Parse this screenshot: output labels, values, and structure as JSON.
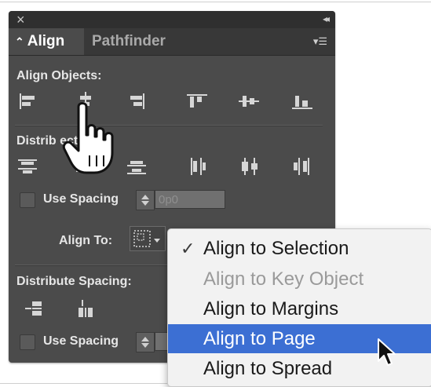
{
  "panel": {
    "close_symbol": "×",
    "collapse_symbol": "◂◂",
    "tabs": [
      {
        "label": "Align",
        "active": true,
        "arrows": "⌃"
      },
      {
        "label": "Pathfinder",
        "active": false
      }
    ],
    "menu_icon": "hamburger-menu-icon",
    "align_objects_label": "Align Objects:",
    "distribute_objects_label": "Distribute Objects:",
    "distribute_objects_visible_text": "Distrib        ects:",
    "use_spacing_label": "Use Spacing",
    "spacing_value": "0p0",
    "align_to_label": "Align To:",
    "distribute_spacing_label": "Distribute Spacing:",
    "use_spacing_label_2": "Use Spacing"
  },
  "menu": {
    "items": [
      {
        "label": "Align to Selection",
        "checked": true,
        "disabled": false,
        "selected": false
      },
      {
        "label": "Align to Key Object",
        "checked": false,
        "disabled": true,
        "selected": false
      },
      {
        "label": "Align to Margins",
        "checked": false,
        "disabled": false,
        "selected": false
      },
      {
        "label": "Align to Page",
        "checked": false,
        "disabled": false,
        "selected": true
      },
      {
        "label": "Align to Spread",
        "checked": false,
        "disabled": false,
        "selected": false
      }
    ],
    "check_symbol": "✓"
  },
  "colors": {
    "panel_bg": "#4b4b4b",
    "selection_blue": "#3c6fd3",
    "menu_bg": "#f2f2f2"
  }
}
